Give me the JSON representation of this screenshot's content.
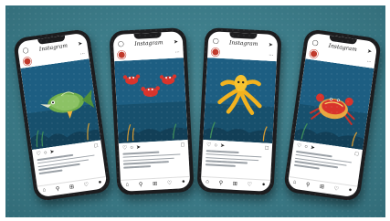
{
  "scene": {
    "background_color": "#3e7f8c",
    "ocean_color": "#1d5e82",
    "phones": [
      {
        "app_title": "Instagram",
        "username": "",
        "caption": "",
        "subject": "fish",
        "icons": [
          "camera-icon",
          "send-icon",
          "heart-icon",
          "comment-icon",
          "share-icon",
          "bookmark-icon",
          "home-icon",
          "search-icon",
          "add-icon",
          "shop-icon",
          "profile-icon"
        ]
      },
      {
        "app_title": "Instagram",
        "username": "",
        "caption": "",
        "subject": "crabs"
      },
      {
        "app_title": "Instagram",
        "username": "",
        "caption": "",
        "subject": "octopus"
      },
      {
        "app_title": "Instagram",
        "username": "",
        "caption": "",
        "subject": "crab-pie"
      }
    ]
  }
}
